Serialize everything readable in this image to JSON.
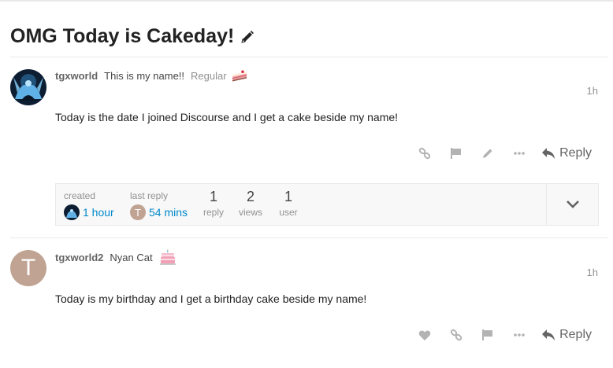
{
  "topic": {
    "title": "OMG Today is Cakeday!"
  },
  "posts": [
    {
      "username": "tgxworld",
      "full_name": "This is my name!!",
      "user_title": "Regular",
      "date": "1h",
      "text": "Today is the date I joined Discourse and I get a cake beside my name!",
      "reply_label": "Reply"
    },
    {
      "username": "tgxworld2",
      "full_name": "Nyan Cat",
      "avatar_letter": "T",
      "date": "1h",
      "text": "Today is my birthday and I get a birthday cake beside my name!",
      "reply_label": "Reply"
    }
  ],
  "topic_map": {
    "created_label": "created",
    "created_time": "1 hour",
    "last_reply_label": "last reply",
    "last_reply_time": "54 mins",
    "last_reply_avatar_letter": "T",
    "reply_count": "1",
    "reply_label": "reply",
    "views_count": "2",
    "views_label": "views",
    "user_count": "1",
    "user_label": "user"
  },
  "colors": {
    "link": "#0088cc",
    "letter_avatar": "#c0a392",
    "icon_muted": "#b3b3b3"
  }
}
